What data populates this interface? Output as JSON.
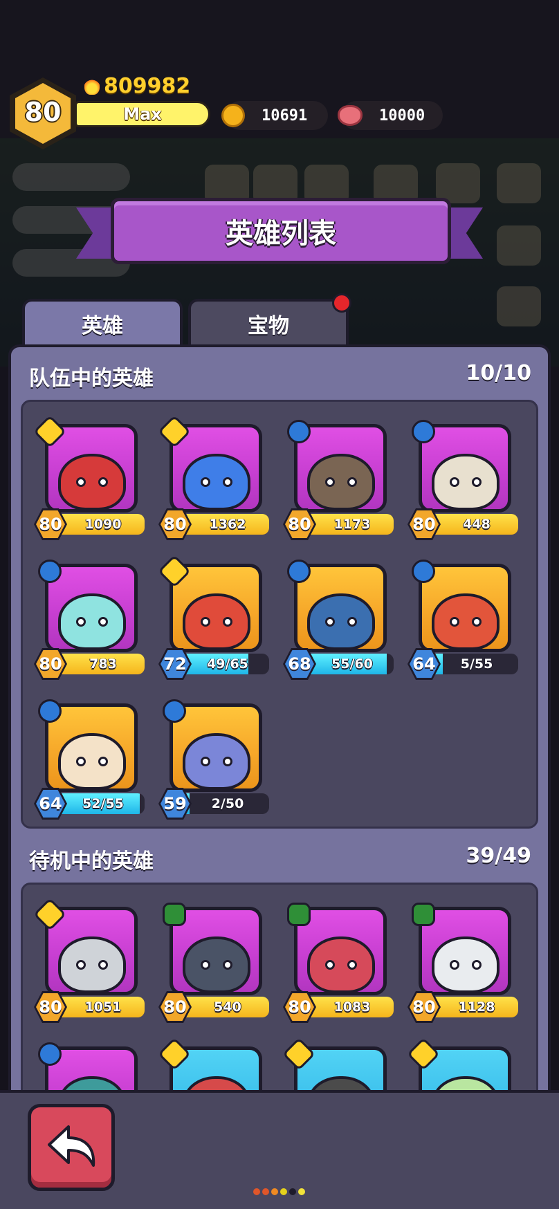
{
  "hud": {
    "player_level": "80",
    "power": "809982",
    "xp_label": "Max",
    "gold": "10691",
    "meat": "10000"
  },
  "title": "英雄列表",
  "tabs": [
    {
      "label": "英雄",
      "active": true
    },
    {
      "label": "宝物",
      "active": false,
      "has_badge": true
    }
  ],
  "team": {
    "title": "队伍中的英雄",
    "count": "10/10",
    "heroes": [
      {
        "level": "80",
        "progress": "1090",
        "fill": 1.0,
        "bar": "gold",
        "class": "gold",
        "bg": "purple",
        "color": "#d63a3a"
      },
      {
        "level": "80",
        "progress": "1362",
        "fill": 1.0,
        "bar": "gold",
        "class": "gold",
        "bg": "purple",
        "color": "#3f7ee8"
      },
      {
        "level": "80",
        "progress": "1173",
        "fill": 1.0,
        "bar": "gold",
        "class": "blue",
        "bg": "purple",
        "color": "#7a6553"
      },
      {
        "level": "80",
        "progress": "448",
        "fill": 1.0,
        "bar": "gold",
        "class": "blue",
        "bg": "purple",
        "color": "#e8e0cf"
      },
      {
        "level": "80",
        "progress": "783",
        "fill": 1.0,
        "bar": "gold",
        "class": "blue",
        "bg": "purple",
        "color": "#8fe3e0"
      },
      {
        "level": "72",
        "progress": "49/65",
        "fill": 0.754,
        "bar": "cyan",
        "class": "gold",
        "bg": "orange",
        "color": "#e04b3a"
      },
      {
        "level": "68",
        "progress": "55/60",
        "fill": 0.917,
        "bar": "cyan",
        "class": "blue",
        "bg": "orange",
        "color": "#3b6fb0"
      },
      {
        "level": "64",
        "progress": "5/55",
        "fill": 0.091,
        "bar": "cyan",
        "class": "blue",
        "bg": "orange",
        "color": "#e2553b"
      },
      {
        "level": "64",
        "progress": "52/55",
        "fill": 0.945,
        "bar": "cyan",
        "class": "blue",
        "bg": "orange",
        "color": "#f4e2c8"
      },
      {
        "level": "59",
        "progress": "2/50",
        "fill": 0.04,
        "bar": "cyan",
        "class": "blue",
        "bg": "orange",
        "color": "#7b86d8"
      }
    ]
  },
  "standby": {
    "title": "待机中的英雄",
    "count": "39/49",
    "heroes": [
      {
        "level": "80",
        "progress": "1051",
        "fill": 1.0,
        "bar": "gold",
        "class": "gold",
        "bg": "purple",
        "color": "#cfd3d8"
      },
      {
        "level": "80",
        "progress": "540",
        "fill": 1.0,
        "bar": "gold",
        "class": "green",
        "bg": "purple",
        "color": "#4a5366"
      },
      {
        "level": "80",
        "progress": "1083",
        "fill": 1.0,
        "bar": "gold",
        "class": "green",
        "bg": "purple",
        "color": "#d64a5a"
      },
      {
        "level": "80",
        "progress": "1128",
        "fill": 1.0,
        "bar": "gold",
        "class": "green",
        "bg": "purple",
        "color": "#e9ecef"
      },
      {
        "class": "blue",
        "bg": "purple",
        "color": "#3e9b9b"
      },
      {
        "class": "gold",
        "bg": "blue",
        "color": "#d64a4a"
      },
      {
        "class": "gold",
        "bg": "blue",
        "color": "#4b4b4b"
      },
      {
        "class": "gold",
        "bg": "blue",
        "color": "#b9e6a0"
      }
    ]
  },
  "icons": {
    "back": "back-arrow-icon",
    "gold": "gold-coin-icon",
    "meat": "meat-icon",
    "power": "flame-icon"
  },
  "page_dots": [
    "#e0562a",
    "#e0562a",
    "#f08a22",
    "#e6d21c",
    "#1e1b2b",
    "#f2e33a"
  ]
}
